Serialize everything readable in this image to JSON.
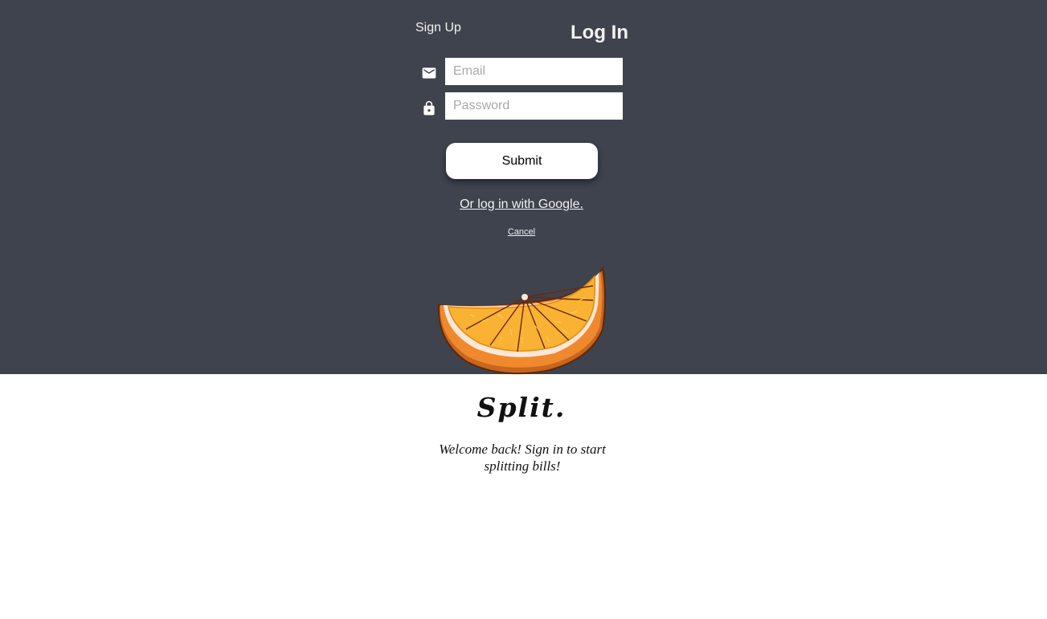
{
  "tabs": {
    "signup_label": "Sign Up",
    "login_label": "Log In"
  },
  "form": {
    "email": {
      "placeholder": "Email",
      "value": "",
      "icon": "mail-icon"
    },
    "password": {
      "placeholder": "Password",
      "value": "",
      "icon": "lock-icon"
    },
    "submit_label": "Submit",
    "google_label": "Or log in with Google.",
    "cancel_label": "Cancel"
  },
  "brand": {
    "name": "Split.",
    "tagline": "Welcome back! Sign in to start splitting bills!",
    "logo": "orange-slice-illustration"
  },
  "colors": {
    "header_bg": "#3e434e",
    "accent": "#f5a623"
  }
}
